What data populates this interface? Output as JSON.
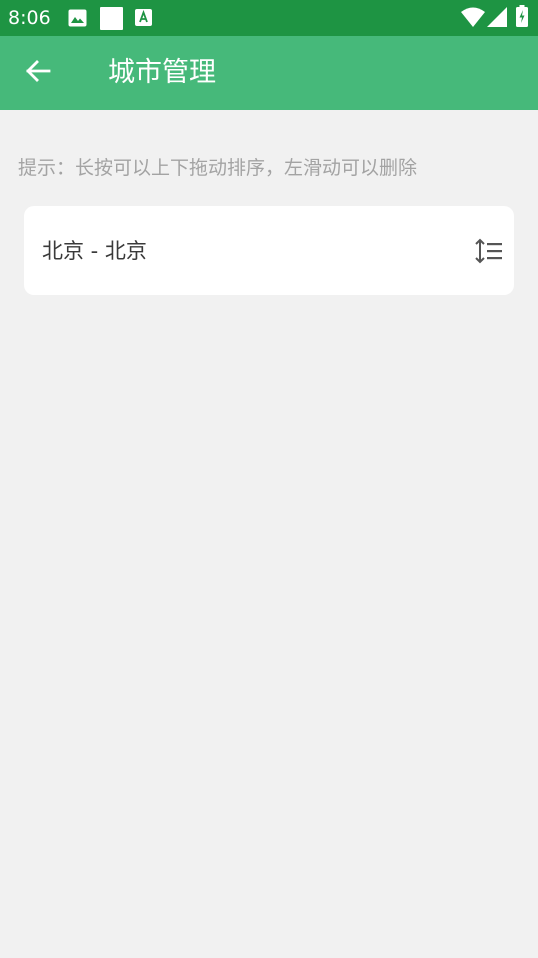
{
  "status_bar": {
    "time": "8:06",
    "icons": [
      "image-icon",
      "blank-square-icon",
      "font-a-icon",
      "wifi-icon",
      "signal-icon",
      "battery-charging-icon"
    ],
    "color": "#1e9443"
  },
  "app_bar": {
    "title": "城市管理",
    "back_icon": "arrow-left-icon",
    "color": "#46b97a"
  },
  "hint": "提示：长按可以上下拖动排序，左滑动可以删除",
  "cities": [
    {
      "name": "北京 - 北京",
      "handle_icon": "sort-drag-icon"
    }
  ]
}
